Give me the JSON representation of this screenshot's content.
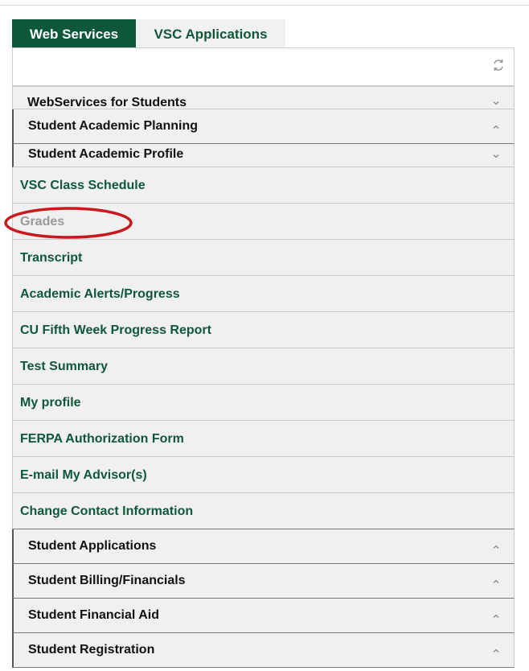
{
  "tabs": {
    "web_services": "Web Services",
    "vsc_applications": "VSC Applications"
  },
  "panel": {
    "refresh_icon": "refresh-icon"
  },
  "menu": {
    "root": {
      "label": "WebServices for Students",
      "icon": "chevron-down-icon"
    },
    "academic_planning": {
      "label": "Student Academic Planning",
      "icon": "chevron-up-icon"
    },
    "academic_profile": {
      "label": "Student Academic Profile",
      "icon": "chevron-down-icon"
    },
    "items": [
      "VSC Class Schedule",
      "Grades",
      "Transcript",
      "Academic Alerts/Progress",
      "CU Fifth Week Progress Report",
      "Test Summary",
      "My profile",
      "FERPA Authorization Form",
      "E-mail My Advisor(s)",
      "Change Contact Information"
    ],
    "sections": [
      "Student Applications",
      "Student Billing/Financials",
      "Student Financial Aid",
      "Student Registration"
    ]
  },
  "colors": {
    "brand_green": "#0f573a",
    "row_background": "#f0f0f0",
    "dimmed_text": "#9a9a9a",
    "highlight_red": "#c8191e"
  }
}
